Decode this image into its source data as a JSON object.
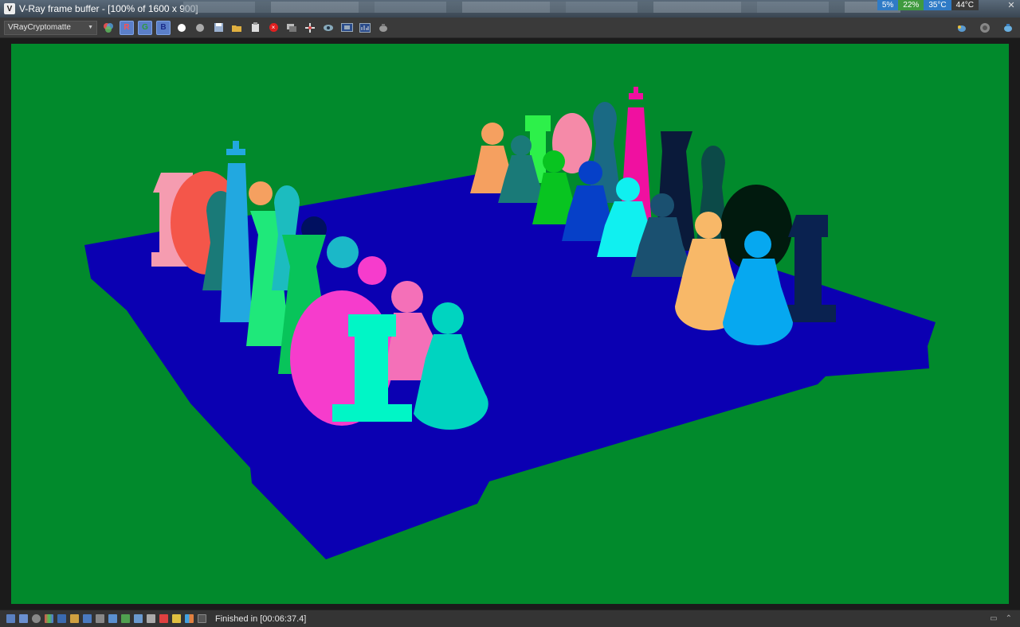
{
  "window": {
    "title": "V-Ray frame buffer - [100% of 1600 x 900]",
    "app_icon_glyph": "V"
  },
  "system_tray": {
    "badges": [
      {
        "label": "5%",
        "color": "#2f7bc6"
      },
      {
        "label": "22%",
        "color": "#3f9a3f"
      },
      {
        "label": "35°C",
        "color": "#2f7bc6"
      },
      {
        "label": "44°C",
        "color": "#3a3a3a"
      }
    ]
  },
  "toolbar": {
    "channel_select": "VRayCryptomatte",
    "r_label": "R",
    "g_label": "G",
    "b_label": "B",
    "stop_glyph": "×"
  },
  "render": {
    "background_color": "#018a2c",
    "table_color": "#0b00b2"
  },
  "status": {
    "text": "Finished in [00:06:37.4]"
  },
  "colors": {
    "titlebar": "#3a4652",
    "toolbar": "#3a3a3a",
    "statusbar": "#343434",
    "rgb_active": "#5b7fc8"
  }
}
